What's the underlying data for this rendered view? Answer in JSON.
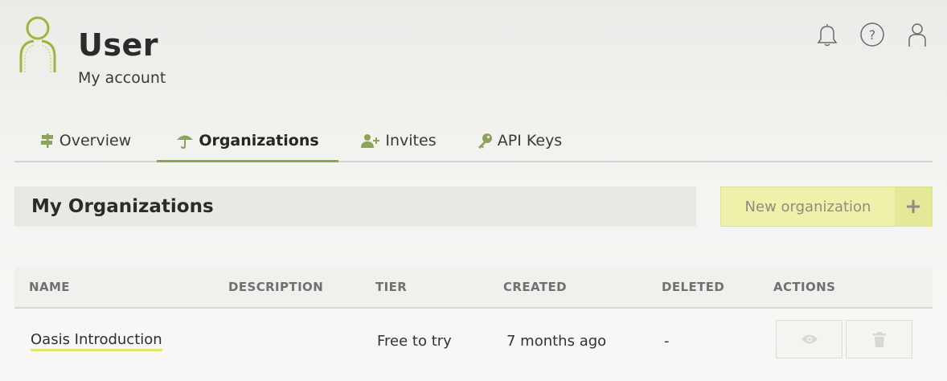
{
  "header": {
    "title": "User",
    "subtitle": "My account",
    "icons": [
      "bell-icon",
      "help-icon",
      "user-icon"
    ]
  },
  "tabs": [
    {
      "label": "Overview",
      "icon": "signpost-icon",
      "active": false
    },
    {
      "label": "Organizations",
      "icon": "umbrella-icon",
      "active": true
    },
    {
      "label": "Invites",
      "icon": "user-plus-icon",
      "active": false
    },
    {
      "label": "API Keys",
      "icon": "key-icon",
      "active": false
    }
  ],
  "section": {
    "title": "My Organizations",
    "new_button_label": "New organization",
    "new_button_plus": "+"
  },
  "table": {
    "columns": [
      "NAME",
      "DESCRIPTION",
      "TIER",
      "CREATED",
      "DELETED",
      "ACTIONS"
    ],
    "rows": [
      {
        "name": "Oasis Introduction",
        "description": "",
        "tier": "Free to try",
        "created": "7 months ago",
        "deleted": "-",
        "actions": [
          "eye-icon",
          "trash-icon"
        ]
      }
    ]
  },
  "colors": {
    "accent": "#8da25a",
    "button_bg": "#edf1a9",
    "link_underline": "#e3e769"
  }
}
